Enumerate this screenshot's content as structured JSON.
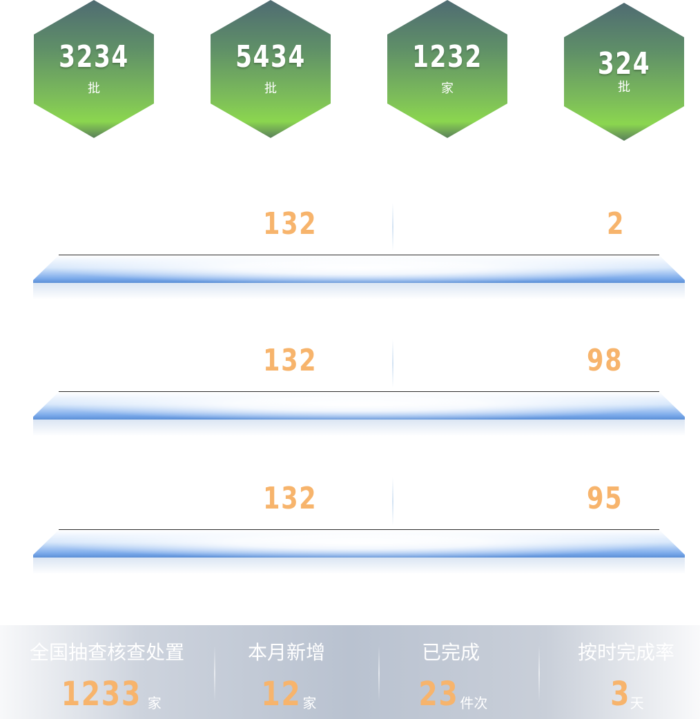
{
  "hexagons": [
    {
      "value": "3234",
      "unit": "批"
    },
    {
      "value": "5434",
      "unit": "批"
    },
    {
      "value": "1232",
      "unit": "家"
    },
    {
      "value": "324",
      "unit": "批"
    }
  ],
  "rows": [
    {
      "left_value": "132",
      "right_value": "2"
    },
    {
      "left_value": "132",
      "right_value": "98"
    },
    {
      "left_value": "132",
      "right_value": "95"
    }
  ],
  "summary": [
    {
      "label": "全国抽查核查处置",
      "value": "1233",
      "unit": "家"
    },
    {
      "label": "本月新增",
      "value": "12",
      "unit": "家"
    },
    {
      "label": "已完成",
      "value": "23",
      "unit": "件次"
    },
    {
      "label": "按时完成率",
      "value": "3",
      "unit": "天"
    }
  ],
  "colors": {
    "accent_orange": "#f7b46c",
    "hex_green": "#8bd64f",
    "hex_slate": "#4f6b72",
    "platform_blue": "#5b8fd6"
  }
}
